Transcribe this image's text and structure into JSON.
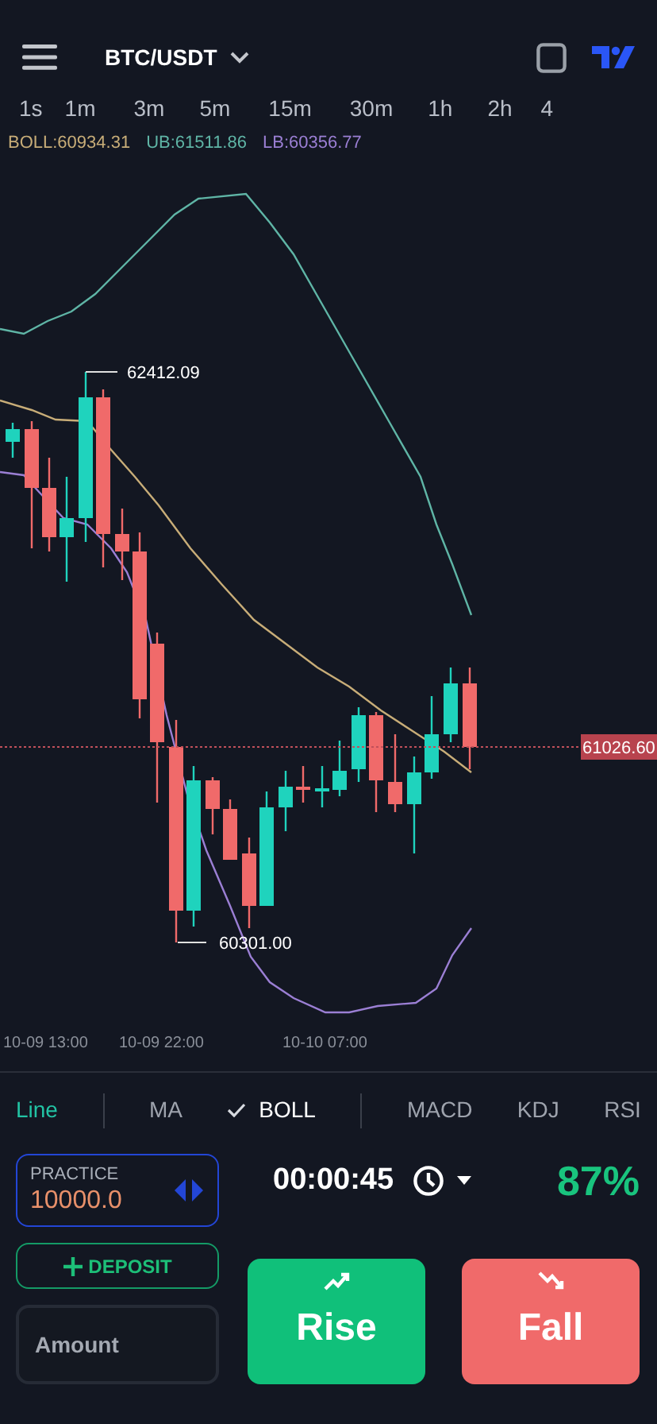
{
  "header": {
    "pair": "BTC/USDT"
  },
  "timeframes": [
    {
      "label": "1s"
    },
    {
      "label": "1m"
    },
    {
      "label": "3m"
    },
    {
      "label": "5m"
    },
    {
      "label": "15m"
    },
    {
      "label": "30m"
    },
    {
      "label": "1h"
    },
    {
      "label": "2h"
    },
    {
      "label": "4"
    }
  ],
  "legend": [
    {
      "label": "BOLL:60934.31",
      "color": "#c8ad78"
    },
    {
      "label": "UB:61511.86",
      "color": "#5fb5a6"
    },
    {
      "label": "LB:60356.77",
      "color": "#9b7fd4"
    }
  ],
  "chart": {
    "high_label": "62412.09",
    "low_label": "60301.00",
    "price_label": "61026.60",
    "x_labels": [
      "10-09 13:00",
      "10-09 22:00",
      "10-10 07:00"
    ]
  },
  "chart_types": [
    {
      "label": "Line",
      "selected": true
    }
  ],
  "main_indicators": [
    {
      "label": "MA",
      "checked": false
    },
    {
      "label": "BOLL",
      "checked": true
    }
  ],
  "sub_indicators": [
    {
      "label": "MACD"
    },
    {
      "label": "KDJ"
    },
    {
      "label": "RSI"
    }
  ],
  "account": {
    "label": "PRACTICE",
    "balance": "10000.0"
  },
  "deposit": {
    "label": "DEPOSIT"
  },
  "amount": {
    "placeholder": "Amount"
  },
  "timer": "00:00:45",
  "payout": "87%",
  "buttons": [
    {
      "kind": "rise",
      "label": "Rise"
    },
    {
      "kind": "fall",
      "label": "Fall"
    }
  ]
}
